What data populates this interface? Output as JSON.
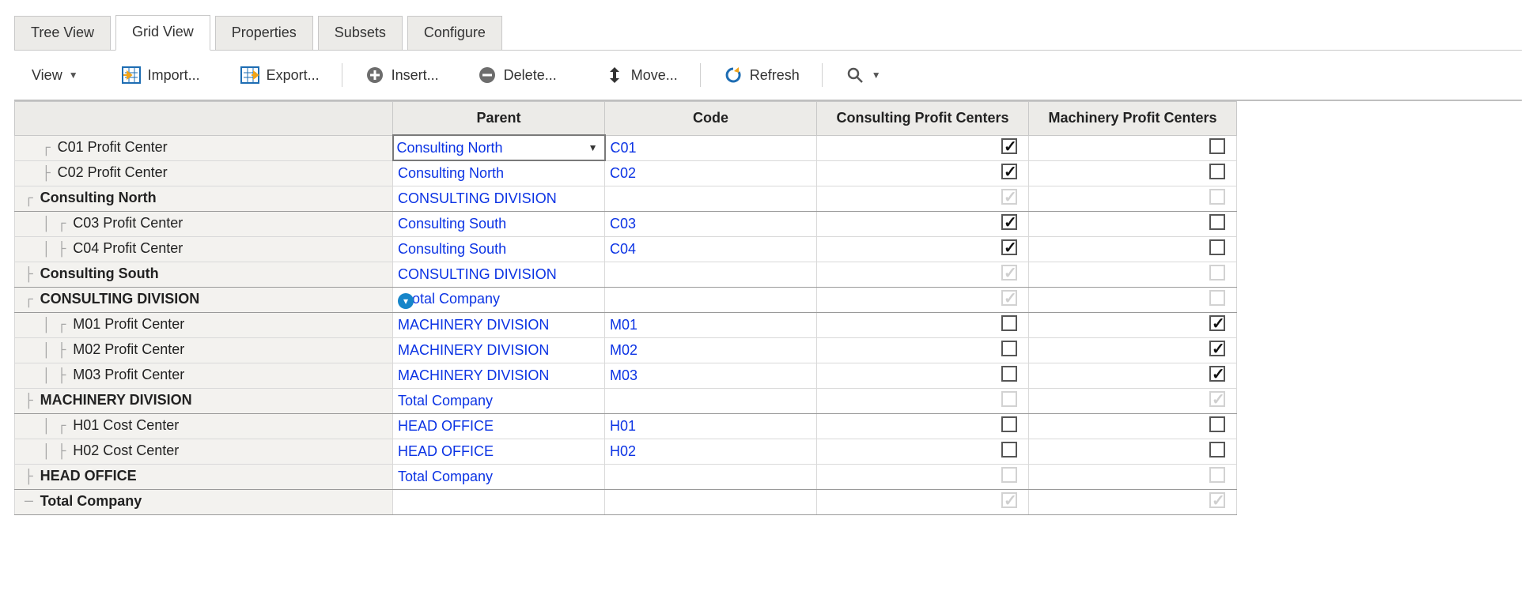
{
  "tabs": {
    "tree_view": "Tree View",
    "grid_view": "Grid View",
    "properties": "Properties",
    "subsets": "Subsets",
    "configure": "Configure",
    "active": "grid_view"
  },
  "toolbar": {
    "view": "View",
    "import": "Import...",
    "export": "Export...",
    "insert": "Insert...",
    "delete": "Delete...",
    "move": "Move...",
    "refresh": "Refresh"
  },
  "columns": {
    "name": "",
    "parent": "Parent",
    "code": "Code",
    "consulting": "Consulting Profit Centers",
    "machinery": "Machinery Profit Centers"
  },
  "rows": [
    {
      "indent": 1,
      "guide": "┌",
      "name": "C01 Profit Center",
      "bold": false,
      "parent": "Consulting North",
      "parent_editing": true,
      "code": "C01",
      "cb_consulting": {
        "checked": true,
        "dim": false
      },
      "cb_machinery": {
        "checked": false,
        "dim": false
      }
    },
    {
      "indent": 1,
      "guide": "├",
      "name": "C02 Profit Center",
      "bold": false,
      "parent": "Consulting North",
      "code": "C02",
      "cb_consulting": {
        "checked": true,
        "dim": false
      },
      "cb_machinery": {
        "checked": false,
        "dim": false
      }
    },
    {
      "indent": 0,
      "guide": "┌",
      "name": "Consulting North",
      "bold": true,
      "parent": "CONSULTING DIVISION",
      "code": "",
      "cb_consulting": {
        "checked": true,
        "dim": true
      },
      "cb_machinery": {
        "checked": false,
        "dim": true
      },
      "rollup": true
    },
    {
      "indent": 1,
      "guide": "│ ┌",
      "name": "C03 Profit Center",
      "bold": false,
      "parent": "Consulting South",
      "code": "C03",
      "cb_consulting": {
        "checked": true,
        "dim": false
      },
      "cb_machinery": {
        "checked": false,
        "dim": false
      }
    },
    {
      "indent": 1,
      "guide": "│ ├",
      "name": "C04 Profit Center",
      "bold": false,
      "parent": "Consulting South",
      "code": "C04",
      "cb_consulting": {
        "checked": true,
        "dim": false
      },
      "cb_machinery": {
        "checked": false,
        "dim": false
      }
    },
    {
      "indent": 0,
      "guide": "├",
      "name": "Consulting South",
      "bold": true,
      "parent": "CONSULTING DIVISION",
      "code": "",
      "cb_consulting": {
        "checked": true,
        "dim": true
      },
      "cb_machinery": {
        "checked": false,
        "dim": true
      },
      "rollup": true
    },
    {
      "indent": 0,
      "guide": "┌",
      "name": "CONSULTING DIVISION",
      "bold": true,
      "parent": "otal Company",
      "parent_badge": true,
      "code": "",
      "cb_consulting": {
        "checked": true,
        "dim": true
      },
      "cb_machinery": {
        "checked": false,
        "dim": true
      },
      "rollup": true
    },
    {
      "indent": 1,
      "guide": "│ ┌",
      "name": "M01 Profit Center",
      "bold": false,
      "parent": "MACHINERY DIVISION",
      "code": "M01",
      "cb_consulting": {
        "checked": false,
        "dim": false
      },
      "cb_machinery": {
        "checked": true,
        "dim": false
      }
    },
    {
      "indent": 1,
      "guide": "│ ├",
      "name": "M02 Profit Center",
      "bold": false,
      "parent": "MACHINERY DIVISION",
      "code": "M02",
      "cb_consulting": {
        "checked": false,
        "dim": false
      },
      "cb_machinery": {
        "checked": true,
        "dim": false
      }
    },
    {
      "indent": 1,
      "guide": "│ ├",
      "name": "M03 Profit Center",
      "bold": false,
      "parent": "MACHINERY DIVISION",
      "code": "M03",
      "cb_consulting": {
        "checked": false,
        "dim": false
      },
      "cb_machinery": {
        "checked": true,
        "dim": false
      }
    },
    {
      "indent": 0,
      "guide": "├",
      "name": "MACHINERY DIVISION",
      "bold": true,
      "parent": "Total Company",
      "code": "",
      "cb_consulting": {
        "checked": false,
        "dim": true
      },
      "cb_machinery": {
        "checked": true,
        "dim": true
      },
      "rollup": true
    },
    {
      "indent": 1,
      "guide": "│ ┌",
      "name": "H01 Cost Center",
      "bold": false,
      "parent": "HEAD OFFICE",
      "code": "H01",
      "cb_consulting": {
        "checked": false,
        "dim": false
      },
      "cb_machinery": {
        "checked": false,
        "dim": false
      }
    },
    {
      "indent": 1,
      "guide": "│ ├",
      "name": "H02 Cost Center",
      "bold": false,
      "parent": "HEAD OFFICE",
      "code": "H02",
      "cb_consulting": {
        "checked": false,
        "dim": false
      },
      "cb_machinery": {
        "checked": false,
        "dim": false
      }
    },
    {
      "indent": 0,
      "guide": "├",
      "name": "HEAD OFFICE",
      "bold": true,
      "parent": "Total Company",
      "code": "",
      "cb_consulting": {
        "checked": false,
        "dim": true
      },
      "cb_machinery": {
        "checked": false,
        "dim": true
      },
      "rollup": true
    },
    {
      "indent": 0,
      "guide": "─",
      "name": "Total Company",
      "bold": true,
      "parent": "",
      "code": "",
      "cb_consulting": {
        "checked": true,
        "dim": true
      },
      "cb_machinery": {
        "checked": true,
        "dim": true
      },
      "rollup": true
    }
  ]
}
